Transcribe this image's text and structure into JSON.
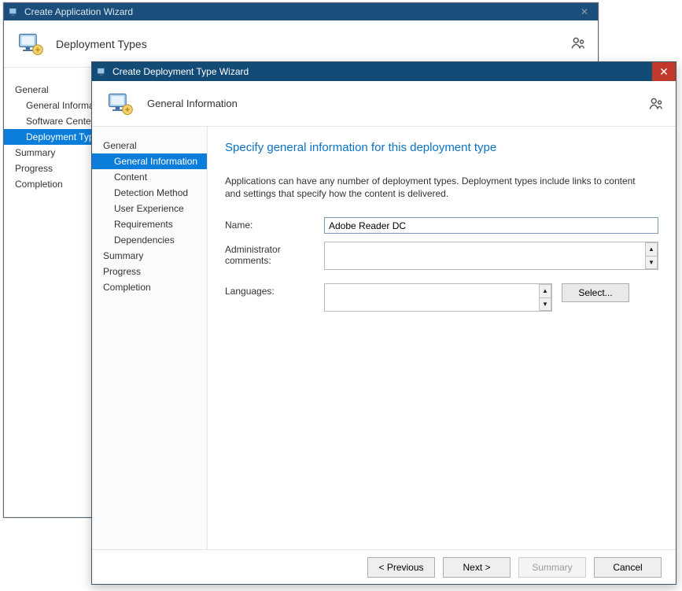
{
  "parent": {
    "title": "Create Application Wizard",
    "header_title": "Deployment Types",
    "sidebar": {
      "general": "General",
      "subs": [
        "General Information",
        "Software Center",
        "Deployment Types"
      ],
      "summary": "Summary",
      "progress": "Progress",
      "completion": "Completion"
    }
  },
  "child": {
    "title": "Create Deployment Type Wizard",
    "header_title": "General Information",
    "sidebar": {
      "general": "General",
      "subs": [
        "General Information",
        "Content",
        "Detection Method",
        "User Experience",
        "Requirements",
        "Dependencies"
      ],
      "summary": "Summary",
      "progress": "Progress",
      "completion": "Completion"
    },
    "page": {
      "heading": "Specify general information for this deployment type",
      "intro": "Applications can have any number of deployment types. Deployment types include links to content and settings that specify how the content is delivered.",
      "labels": {
        "name": "Name:",
        "admin_comments": "Administrator comments:",
        "languages": "Languages:"
      },
      "values": {
        "name": "Adobe Reader DC",
        "admin_comments": "",
        "languages": ""
      },
      "select_btn": "Select..."
    },
    "footer": {
      "previous": "< Previous",
      "next": "Next >",
      "summary": "Summary",
      "cancel": "Cancel"
    }
  }
}
